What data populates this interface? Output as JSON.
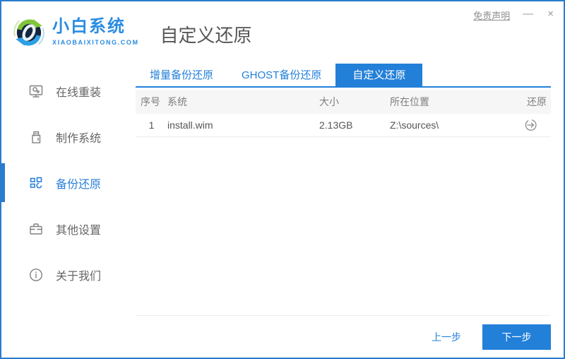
{
  "window": {
    "minimize": "—",
    "close": "×"
  },
  "header": {
    "logo": {
      "brand": "小白系统",
      "domain": "XIAOBAIXITONG.COM"
    },
    "title": "自定义还原",
    "disclaimer": "免责声明"
  },
  "sidebar": {
    "items": [
      {
        "label": "在线重装",
        "icon": "monitor-icon",
        "active": false
      },
      {
        "label": "制作系统",
        "icon": "usb-icon",
        "active": false
      },
      {
        "label": "备份还原",
        "icon": "tiles-icon",
        "active": true
      },
      {
        "label": "其他设置",
        "icon": "briefcase-icon",
        "active": false
      },
      {
        "label": "关于我们",
        "icon": "info-icon",
        "active": false
      }
    ]
  },
  "tabs": [
    {
      "label": "增量备份还原",
      "active": false
    },
    {
      "label": "GHOST备份还原",
      "active": false
    },
    {
      "label": "自定义还原",
      "active": true
    }
  ],
  "table": {
    "headers": [
      "序号",
      "系统",
      "大小",
      "所在位置",
      "还原"
    ],
    "rows": [
      {
        "index": "1",
        "system": "install.wim",
        "size": "2.13GB",
        "location": "Z:\\sources\\",
        "action_icon": "restore-icon"
      }
    ]
  },
  "footer": {
    "prev": "上一步",
    "next": "下一步"
  },
  "colors": {
    "accent": "#2380d9",
    "window_border": "#2a7ccd",
    "logo_blue": "#2a8ce2",
    "text_gray": "#666666",
    "table_header_bg": "#f6f6f6"
  }
}
